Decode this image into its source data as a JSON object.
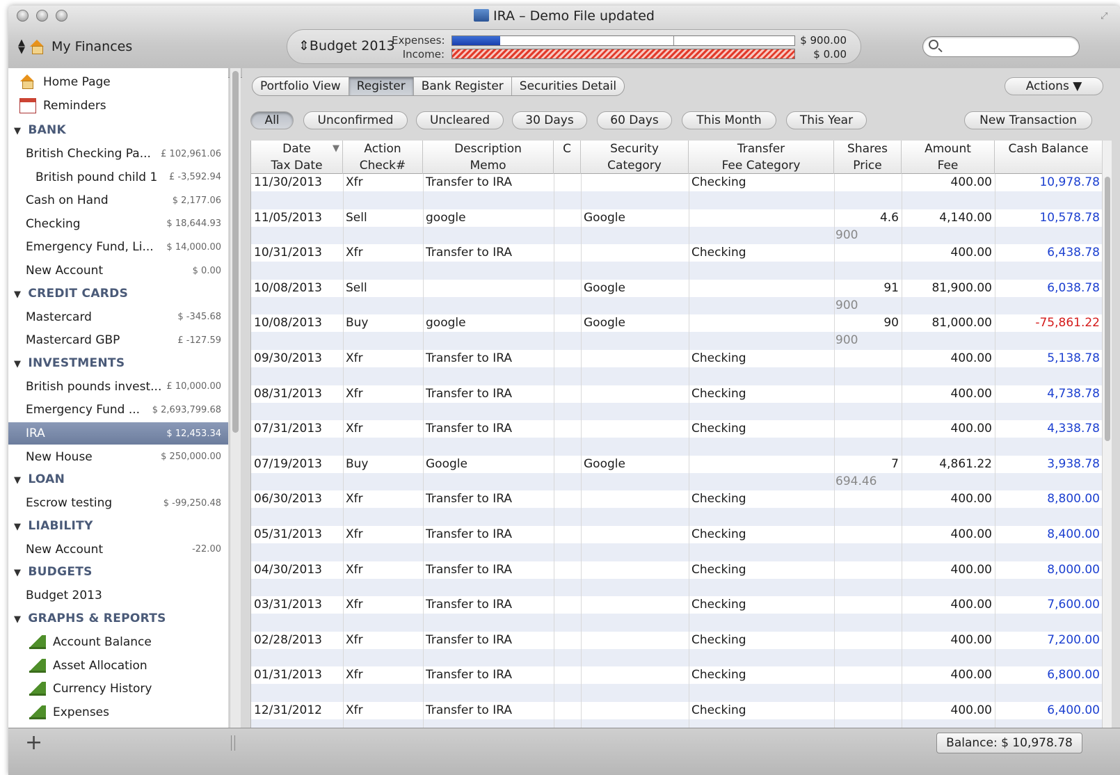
{
  "window": {
    "title": "IRA – Demo File updated"
  },
  "account_switcher": {
    "label": "My Finances"
  },
  "budget": {
    "name": "Budget 2013",
    "expenses_label": "Expenses:",
    "income_label": "Income:",
    "expenses_amount": "$ 900.00",
    "income_amount": "$ 0.00",
    "expenses_fill_fraction": 0.14,
    "income_fill_fraction": 1.0
  },
  "search": {
    "placeholder": "",
    "value": ""
  },
  "sidebar": {
    "top": [
      {
        "label": "Home Page",
        "icon": "house-icon"
      },
      {
        "label": "Reminders",
        "icon": "calendar-icon"
      }
    ],
    "sections": [
      {
        "title": "BANK",
        "items": [
          {
            "label": "British Checking Pa...",
            "balance": "£ 102,961.06"
          },
          {
            "label": "British pound child 1",
            "balance": "£ -3,592.94",
            "indent": true
          },
          {
            "label": "Cash on Hand",
            "balance": "$ 2,177.06"
          },
          {
            "label": "Checking",
            "balance": "$ 18,644.93"
          },
          {
            "label": "Emergency Fund, Li...",
            "balance": "$ 14,000.00"
          },
          {
            "label": "New Account",
            "balance": "$ 0.00"
          }
        ]
      },
      {
        "title": "CREDIT CARDS",
        "items": [
          {
            "label": "Mastercard",
            "balance": "$ -345.68"
          },
          {
            "label": "Mastercard GBP",
            "balance": "£ -127.59"
          }
        ]
      },
      {
        "title": "INVESTMENTS",
        "items": [
          {
            "label": "British pounds invest...",
            "balance": "£ 10,000.00"
          },
          {
            "label": "Emergency Fund ...",
            "balance": "$ 2,693,799.68"
          },
          {
            "label": "IRA",
            "balance": "$ 12,453.34",
            "selected": true
          },
          {
            "label": "New House",
            "balance": "$ 250,000.00"
          }
        ]
      },
      {
        "title": "LOAN",
        "items": [
          {
            "label": "Escrow testing",
            "balance": "$ -99,250.48"
          }
        ]
      },
      {
        "title": "LIABILITY",
        "items": [
          {
            "label": "New Account",
            "balance": "-22.00"
          }
        ]
      },
      {
        "title": "BUDGETS",
        "items": [
          {
            "label": "Budget 2013",
            "balance": ""
          }
        ]
      },
      {
        "title": "GRAPHS & REPORTS",
        "items": [
          {
            "label": "Account Balance",
            "icon": "chart-icon"
          },
          {
            "label": "Asset Allocation",
            "icon": "chart-icon"
          },
          {
            "label": "Currency History",
            "icon": "chart-icon"
          },
          {
            "label": "Expenses",
            "icon": "chart-icon"
          }
        ]
      }
    ]
  },
  "view_tabs": [
    {
      "label": "Portfolio View"
    },
    {
      "label": "Register",
      "active": true
    },
    {
      "label": "Bank Register"
    },
    {
      "label": "Securities Detail"
    }
  ],
  "actions_label": "Actions ▼",
  "filters": [
    {
      "label": "All",
      "active": true
    },
    {
      "label": "Unconfirmed"
    },
    {
      "label": "Uncleared"
    },
    {
      "label": "30 Days"
    },
    {
      "label": "60 Days"
    },
    {
      "label": "This Month"
    },
    {
      "label": "This Year"
    }
  ],
  "new_transaction_label": "New Transaction",
  "columns": [
    {
      "l1": "Date",
      "l2": "Tax Date",
      "sort": "▼"
    },
    {
      "l1": "Action",
      "l2": "Check#"
    },
    {
      "l1": "Description",
      "l2": "Memo"
    },
    {
      "l1": "C",
      "l2": ""
    },
    {
      "l1": "Security",
      "l2": "Category"
    },
    {
      "l1": "Transfer",
      "l2": "Fee Category"
    },
    {
      "l1": "Shares",
      "l2": "Price"
    },
    {
      "l1": "Amount",
      "l2": "Fee"
    },
    {
      "l1": "Cash Balance",
      "l2": ""
    }
  ],
  "transactions": [
    {
      "date": "11/30/2013",
      "action": "Xfr",
      "desc": "Transfer to IRA",
      "security": "",
      "transfer": "Checking",
      "shares": "",
      "price": "",
      "amount": "400.00",
      "balance": "10,978.78",
      "neg": false
    },
    {
      "date": "11/05/2013",
      "action": "Sell",
      "desc": "google",
      "security": "Google",
      "transfer": "",
      "shares": "4.6",
      "price": "900",
      "amount": "4,140.00",
      "balance": "10,578.78",
      "neg": false
    },
    {
      "date": "10/31/2013",
      "action": "Xfr",
      "desc": "Transfer to IRA",
      "security": "",
      "transfer": "Checking",
      "shares": "",
      "price": "",
      "amount": "400.00",
      "balance": "6,438.78",
      "neg": false
    },
    {
      "date": "10/08/2013",
      "action": "Sell",
      "desc": "",
      "security": "Google",
      "transfer": "",
      "shares": "91",
      "price": "900",
      "amount": "81,900.00",
      "balance": "6,038.78",
      "neg": false
    },
    {
      "date": "10/08/2013",
      "action": "Buy",
      "desc": "google",
      "security": "Google",
      "transfer": "",
      "shares": "90",
      "price": "900",
      "amount": "81,000.00",
      "balance": "-75,861.22",
      "neg": true
    },
    {
      "date": "09/30/2013",
      "action": "Xfr",
      "desc": "Transfer to IRA",
      "security": "",
      "transfer": "Checking",
      "shares": "",
      "price": "",
      "amount": "400.00",
      "balance": "5,138.78",
      "neg": false
    },
    {
      "date": "08/31/2013",
      "action": "Xfr",
      "desc": "Transfer to IRA",
      "security": "",
      "transfer": "Checking",
      "shares": "",
      "price": "",
      "amount": "400.00",
      "balance": "4,738.78",
      "neg": false
    },
    {
      "date": "07/31/2013",
      "action": "Xfr",
      "desc": "Transfer to IRA",
      "security": "",
      "transfer": "Checking",
      "shares": "",
      "price": "",
      "amount": "400.00",
      "balance": "4,338.78",
      "neg": false
    },
    {
      "date": "07/19/2013",
      "action": "Buy",
      "desc": "Google",
      "security": "Google",
      "transfer": "",
      "shares": "7",
      "price": "694.46",
      "amount": "4,861.22",
      "balance": "3,938.78",
      "neg": false
    },
    {
      "date": "06/30/2013",
      "action": "Xfr",
      "desc": "Transfer to IRA",
      "security": "",
      "transfer": "Checking",
      "shares": "",
      "price": "",
      "amount": "400.00",
      "balance": "8,800.00",
      "neg": false
    },
    {
      "date": "05/31/2013",
      "action": "Xfr",
      "desc": "Transfer to IRA",
      "security": "",
      "transfer": "Checking",
      "shares": "",
      "price": "",
      "amount": "400.00",
      "balance": "8,400.00",
      "neg": false
    },
    {
      "date": "04/30/2013",
      "action": "Xfr",
      "desc": "Transfer to IRA",
      "security": "",
      "transfer": "Checking",
      "shares": "",
      "price": "",
      "amount": "400.00",
      "balance": "8,000.00",
      "neg": false
    },
    {
      "date": "03/31/2013",
      "action": "Xfr",
      "desc": "Transfer to IRA",
      "security": "",
      "transfer": "Checking",
      "shares": "",
      "price": "",
      "amount": "400.00",
      "balance": "7,600.00",
      "neg": false
    },
    {
      "date": "02/28/2013",
      "action": "Xfr",
      "desc": "Transfer to IRA",
      "security": "",
      "transfer": "Checking",
      "shares": "",
      "price": "",
      "amount": "400.00",
      "balance": "7,200.00",
      "neg": false
    },
    {
      "date": "01/31/2013",
      "action": "Xfr",
      "desc": "Transfer to IRA",
      "security": "",
      "transfer": "Checking",
      "shares": "",
      "price": "",
      "amount": "400.00",
      "balance": "6,800.00",
      "neg": false
    },
    {
      "date": "12/31/2012",
      "action": "Xfr",
      "desc": "Transfer to IRA",
      "security": "",
      "transfer": "Checking",
      "shares": "",
      "price": "",
      "amount": "400.00",
      "balance": "6,400.00",
      "neg": false
    }
  ],
  "status_bar": {
    "add_label": "+",
    "balance": "Balance: $ 10,978.78"
  },
  "colors": {
    "positive_balance": "#1b3fd0",
    "negative_balance": "#d41a1a",
    "selected_row": "#7b8aa9",
    "alt_row": "#e9edf6"
  }
}
